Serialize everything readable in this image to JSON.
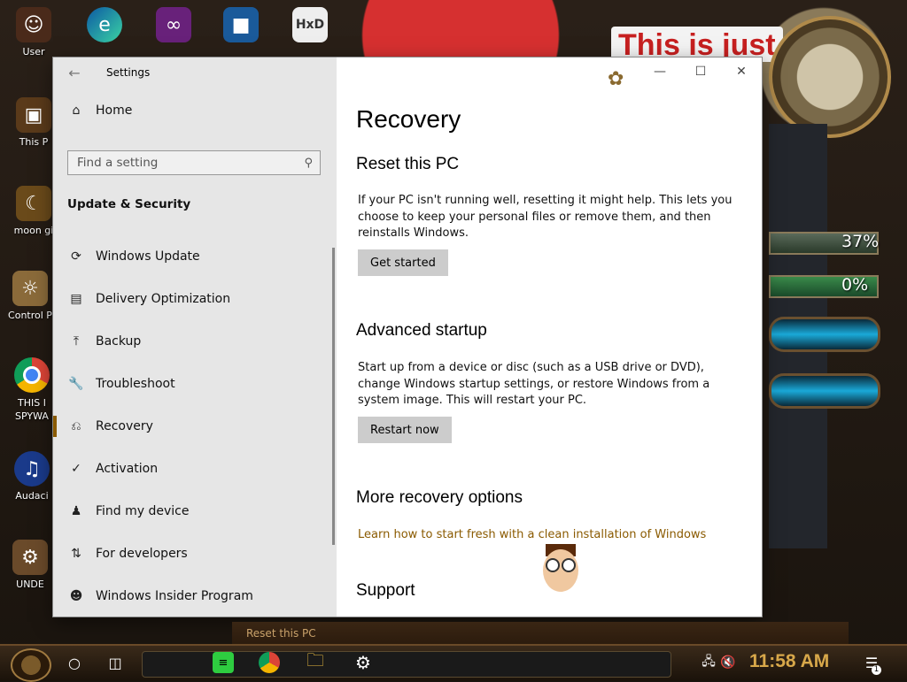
{
  "desktop": {
    "icons": [
      {
        "label": "User",
        "icon": "user-folder-icon"
      },
      {
        "label": "This P",
        "icon": "this-pc-icon"
      },
      {
        "label": "moon gi",
        "icon": "moon-icon"
      },
      {
        "label": "Control P",
        "icon": "control-panel-icon"
      },
      {
        "label": "THIS I SPYWA",
        "icon": "chrome-icon"
      },
      {
        "label": "Audaci",
        "icon": "audacity-icon"
      },
      {
        "label": "UNDE",
        "icon": "folder-icon"
      }
    ],
    "top_icons": [
      "edge-icon",
      "visual-studio-icon",
      "virtualbox-icon",
      "hxd-icon"
    ],
    "banner": "This is just",
    "gauges": [
      {
        "percent_label": "37%"
      },
      {
        "percent_label": "0%"
      }
    ],
    "colors": {
      "banner_red": "#c72020",
      "accent_brown": "#8a5a00"
    }
  },
  "window": {
    "app_title": "Settings",
    "controls": {
      "minimize": "—",
      "maximize": "☐",
      "close": "✕"
    }
  },
  "nav": {
    "home": "Home",
    "search_placeholder": "Find a setting",
    "section": "Update & Security",
    "items": [
      {
        "label": "Windows Update",
        "icon": "sync-icon"
      },
      {
        "label": "Delivery Optimization",
        "icon": "delivery-optimization-icon"
      },
      {
        "label": "Backup",
        "icon": "backup-arrow-icon"
      },
      {
        "label": "Troubleshoot",
        "icon": "wrench-icon"
      },
      {
        "label": "Recovery",
        "icon": "recovery-icon",
        "selected": true
      },
      {
        "label": "Activation",
        "icon": "checkmark-circle-icon"
      },
      {
        "label": "Find my device",
        "icon": "person-location-icon"
      },
      {
        "label": "For developers",
        "icon": "developer-sliders-icon"
      },
      {
        "label": "Windows Insider Program",
        "icon": "insider-cat-icon"
      }
    ]
  },
  "content": {
    "page_title": "Recovery",
    "reset": {
      "heading": "Reset this PC",
      "description": "If your PC isn't running well, resetting it might help. This lets you choose to keep your personal files or remove them, and then reinstalls Windows.",
      "button": "Get started"
    },
    "advanced": {
      "heading": "Advanced startup",
      "description": "Start up from a device or disc (such as a USB drive or DVD), change Windows startup settings, or restore Windows from a system image. This will restart your PC.",
      "button": "Restart now"
    },
    "more": {
      "heading": "More recovery options",
      "link": "Learn how to start fresh with a clean installation of Windows"
    },
    "support": {
      "heading": "Support"
    }
  },
  "taskbar": {
    "tooltip": "Reset this PC",
    "time": "11:58 AM",
    "notification_count": "1",
    "pinned": [
      "spotify-icon",
      "chrome-icon",
      "file-explorer-icon",
      "settings-gear-icon"
    ]
  }
}
